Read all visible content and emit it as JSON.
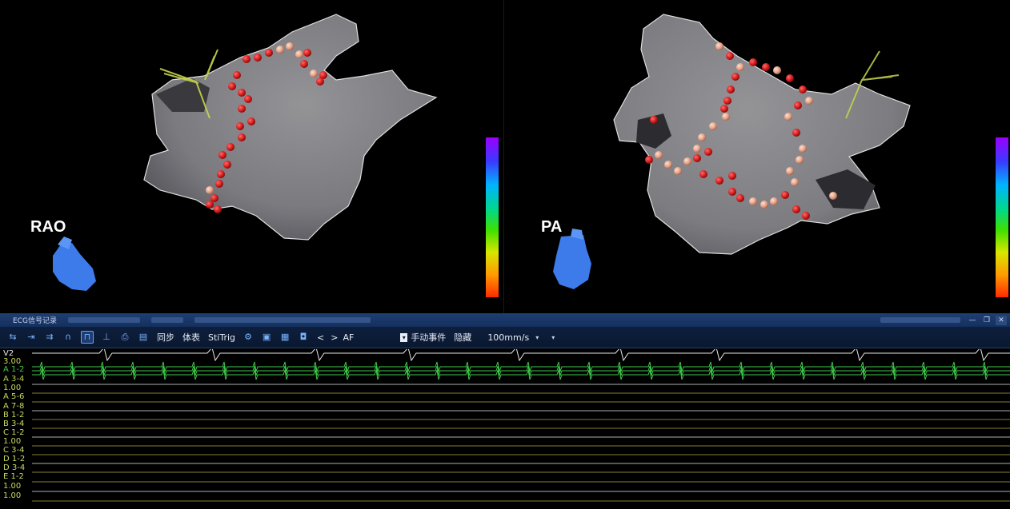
{
  "views": {
    "left": {
      "label": "RAO"
    },
    "right": {
      "label": "PA"
    }
  },
  "colors": {
    "mesh": "#8f8f93",
    "lesion_red": "#d42020",
    "lesion_pink": "#e7a58c",
    "heart_icon": "#3e7bea",
    "catheter": "#c6d44a",
    "toolbar_bg": "#0d1f3e",
    "trace_green": "#3fc94a",
    "trace_white": "#e8e8e8",
    "trace_yellow": "#b5a54a"
  },
  "ecg_window": {
    "title": "ECG信号记录",
    "window_controls": [
      "—",
      "❐",
      "✕"
    ],
    "toolbar": {
      "icons": [
        "align-left-icon",
        "align-center-icon",
        "align-right-icon",
        "split-icon",
        "layout-icon",
        "ruler-icon",
        "print-icon",
        "calc-icon"
      ],
      "sync_label": "同步",
      "surface_label": "体表",
      "stitrig_label": "StiTrig",
      "icons2": [
        "settings-icon",
        "page-icon",
        "grid-icon",
        "save-icon"
      ],
      "prev_label": "<",
      "next_label": ">",
      "af_label": "AF",
      "manual_event_label": "手动事件",
      "hide_label": "隐藏",
      "speed_value": "100mm/s"
    },
    "channels": [
      "V2",
      "3.00",
      "A 1-2",
      "A 3-4",
      "1.00",
      "A 5-6",
      "A 7-8",
      "B 1-2",
      "B 3-4",
      "C 1-2",
      "1.00",
      "C 3-4",
      "D 1-2",
      "D 3-4",
      "E 1-2",
      "1.00",
      "1.00"
    ]
  }
}
